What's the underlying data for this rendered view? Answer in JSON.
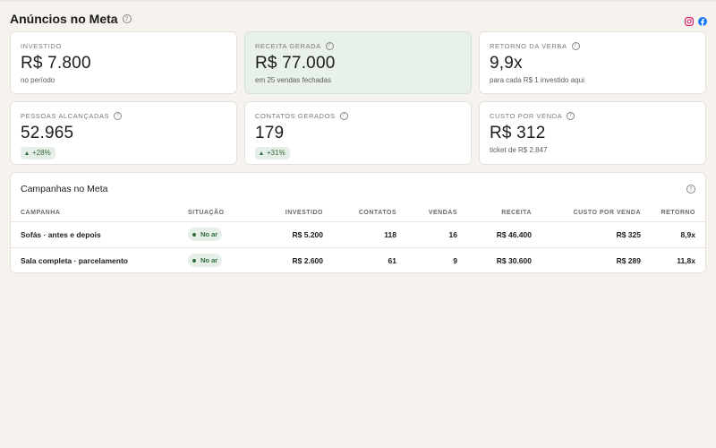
{
  "header": {
    "title": "Anúncios no Meta",
    "help_icon": "?",
    "icons": [
      "instagram-icon",
      "facebook-icon"
    ]
  },
  "colors": {
    "background": "#f6f3ee",
    "highlight_card": "#e8f1ea",
    "positive": "#2f6b3c",
    "instagram": "#d6286f",
    "facebook": "#1877f2"
  },
  "metrics": [
    {
      "label": "INVESTIDO",
      "value": "R$ 7.800",
      "sub": "no período",
      "help": false
    },
    {
      "label": "RECEITA GERADA",
      "value": "R$ 77.000",
      "sub": "em 25 vendas fechadas",
      "help": true
    },
    {
      "label": "RETORNO DA VERBA",
      "value": "9,9x",
      "sub": "para cada R$ 1 investido aqui",
      "help": true
    },
    {
      "label": "PESSOAS ALCANÇADAS",
      "value": "52.965",
      "badge": "+28%",
      "help": true
    },
    {
      "label": "CONTATOS GERADOS",
      "value": "179",
      "badge": "+31%",
      "help": true
    },
    {
      "label": "CUSTO POR VENDA",
      "value": "R$ 312",
      "sub": "ticket de R$ 2.847",
      "help": true
    }
  ],
  "campaigns": {
    "title": "Campanhas no Meta",
    "columns": [
      "CAMPANHA",
      "SITUAÇÃO",
      "INVESTIDO",
      "CONTATOS",
      "VENDAS",
      "RECEITA",
      "CUSTO POR VENDA",
      "RETORNO"
    ],
    "rows": [
      {
        "name": "Sofás · antes e depois",
        "status": "No ar",
        "invested": "R$ 5.200",
        "contacts": "118",
        "sales": "16",
        "revenue": "R$ 46.400",
        "cost_per_sale": "R$ 325",
        "return": "8,9x"
      },
      {
        "name": "Sala completa · parcelamento",
        "status": "No ar",
        "invested": "R$ 2.600",
        "contacts": "61",
        "sales": "9",
        "revenue": "R$ 30.600",
        "cost_per_sale": "R$ 289",
        "return": "11,8x"
      }
    ]
  }
}
